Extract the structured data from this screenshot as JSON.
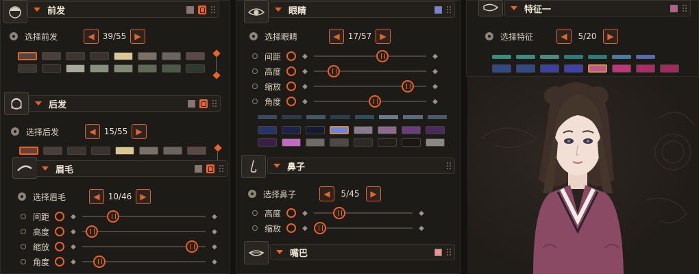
{
  "sections": {
    "front_hair": {
      "title": "前发",
      "select_label": "选择前发",
      "counter": "39/55",
      "swatch_color": "#8a7470"
    },
    "back_hair": {
      "title": "后发",
      "select_label": "选择后发",
      "counter": "15/55",
      "swatch_color": "#8a7470"
    },
    "eyebrow": {
      "title": "眉毛",
      "select_label": "选择眉毛",
      "counter": "10/46",
      "swatch_color": "#8a7470",
      "sliders": [
        {
          "label": "间距",
          "value": 0.22
        },
        {
          "label": "高度",
          "value": 0.03
        },
        {
          "label": "缩放",
          "value": 0.93
        },
        {
          "label": "角度",
          "value": 0.1
        }
      ]
    },
    "eyes": {
      "title": "眼睛",
      "select_label": "选择眼睛",
      "counter": "17/57",
      "swatch_color": "#6f86d8",
      "sliders": [
        {
          "label": "间距",
          "value": 0.62
        },
        {
          "label": "高度",
          "value": 0.14
        },
        {
          "label": "缩放",
          "value": 0.88
        },
        {
          "label": "角度",
          "value": 0.55
        }
      ]
    },
    "nose": {
      "title": "鼻子",
      "select_label": "选择鼻子",
      "counter": "5/45",
      "sliders": [
        {
          "label": "高度",
          "value": 0.22
        },
        {
          "label": "缩放",
          "value": 0.0
        }
      ]
    },
    "mouth": {
      "title": "嘴巴",
      "swatch_color": "#ef8f8f"
    },
    "feature1": {
      "title": "特征一",
      "select_label": "选择特征",
      "counter": "5/20",
      "swatch_color": "#c05a8a"
    }
  },
  "palettes": {
    "front_hair": [
      "#4e4640",
      "#4a3f3a",
      "#3e3531",
      "#3a3230",
      "#d9c795",
      "#7a7068",
      "#6c6460",
      "#5a4a45",
      "#3a352e",
      "#2e2a25",
      "#a8aa9e",
      "#88907f",
      "#7e8a72",
      "#5e6a56",
      "#4a5a48",
      "#2e3a2c"
    ],
    "back_hair": [
      "#6a3f35",
      "#4a3f3a",
      "#3e3531",
      "#3a3230",
      "#d9c795",
      "#7a7068",
      "#6c6460",
      "#5a4a45"
    ],
    "eyes": [
      "#263466",
      "#1a2248",
      "#141a30",
      "#6f86d8",
      "#857c8e",
      "#8b6a8e",
      "#6a3e7a",
      "#4a2a5e",
      "#3a1e48",
      "#c26ac6",
      "#6f6b68",
      "#4c4946",
      "#2c2a28",
      "#211f1e",
      "#1a1918",
      "#8a8784"
    ],
    "feature1_top": [
      "#3c8a80",
      "#3c8a80",
      "#4a8a80",
      "#2e7a78",
      "#2e7a78",
      "#4a7aa0",
      "#5a6aa8"
    ],
    "feature1": [
      "#2e4a8a",
      "#2e4a8a",
      "#3a40a8",
      "#4040b0",
      "#c05a8a",
      "#c0357a",
      "#b02a6a",
      "#a02a60"
    ]
  },
  "icons": [
    "hair-icon",
    "eye-icon",
    "eyebrow-icon",
    "nose-icon",
    "mouth-icon",
    "feature-icon"
  ],
  "accent": "#e8632a"
}
